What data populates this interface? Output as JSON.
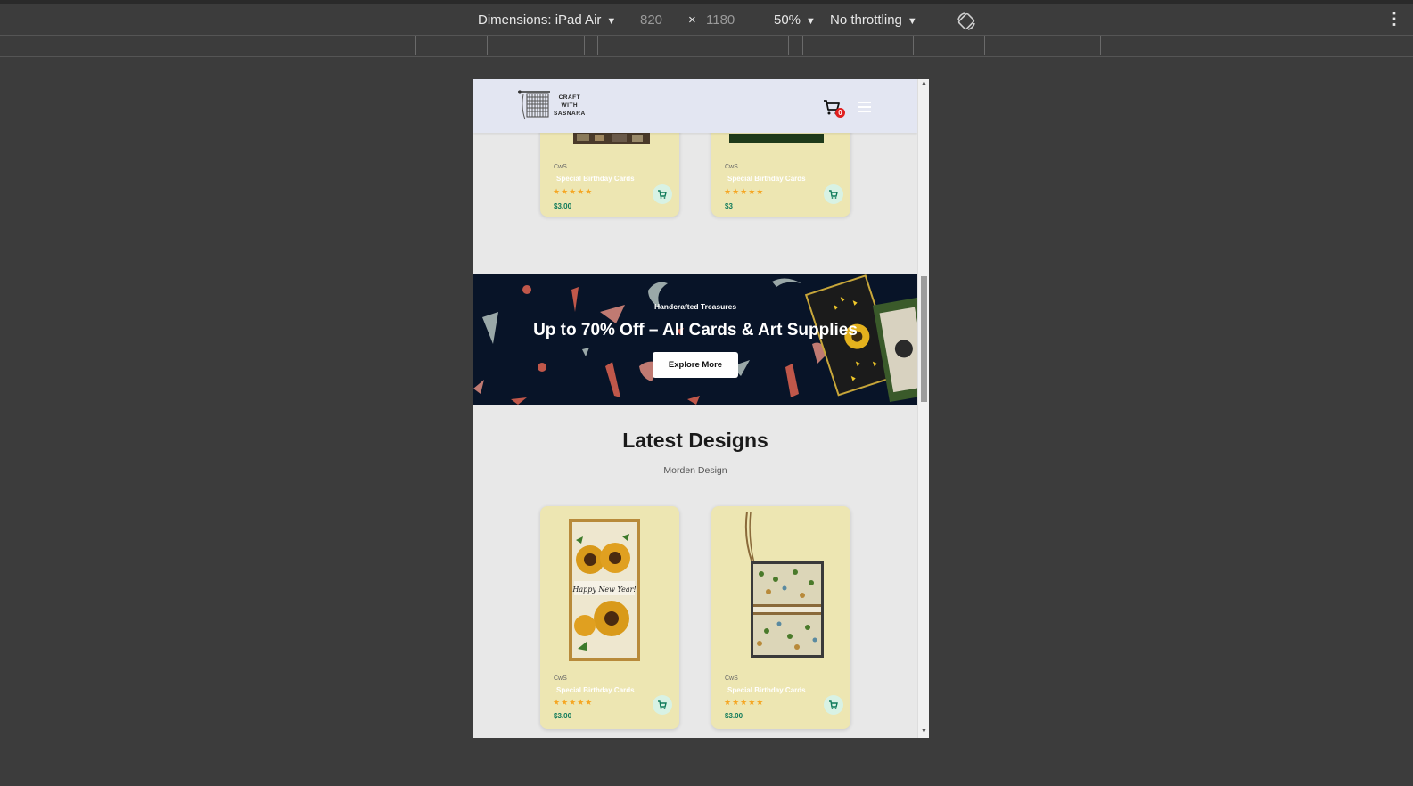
{
  "devtools": {
    "dimensions_label": "Dimensions: iPad Air",
    "width": "820",
    "times": "×",
    "height": "1180",
    "zoom": "50%",
    "throttling": "No throttling",
    "more": "⋮"
  },
  "nav": {
    "logo_text": "CRAFT\nWITH\nSASNARA",
    "cart_count": "0"
  },
  "top_products": [
    {
      "brand": "CwS",
      "name": "Special Birthday Cards",
      "stars": "★★★★★",
      "price": "$3.00"
    },
    {
      "brand": "CwS",
      "name": "Special Birthday Cards",
      "stars": "★★★★★",
      "price": "$3"
    }
  ],
  "banner": {
    "subtitle": "Handcrafted Treasures",
    "title": "Up to 70% Off – All Cards & Art Supplies",
    "button": "Explore More"
  },
  "latest": {
    "title": "Latest Designs",
    "subtitle": "Morden Design",
    "products": [
      {
        "brand": "CwS",
        "name": "Special Birthday Cards",
        "stars": "★★★★★",
        "price": "$3.00",
        "image_text": "Happy New Year!"
      },
      {
        "brand": "CwS",
        "name": "Special Birthday Cards",
        "stars": "★★★★★",
        "price": "$3.00"
      }
    ]
  },
  "colors": {
    "card_bg": "#ede6b2",
    "banner_bg": "#081428",
    "price": "#0f7a5a",
    "star": "#f5a623"
  }
}
